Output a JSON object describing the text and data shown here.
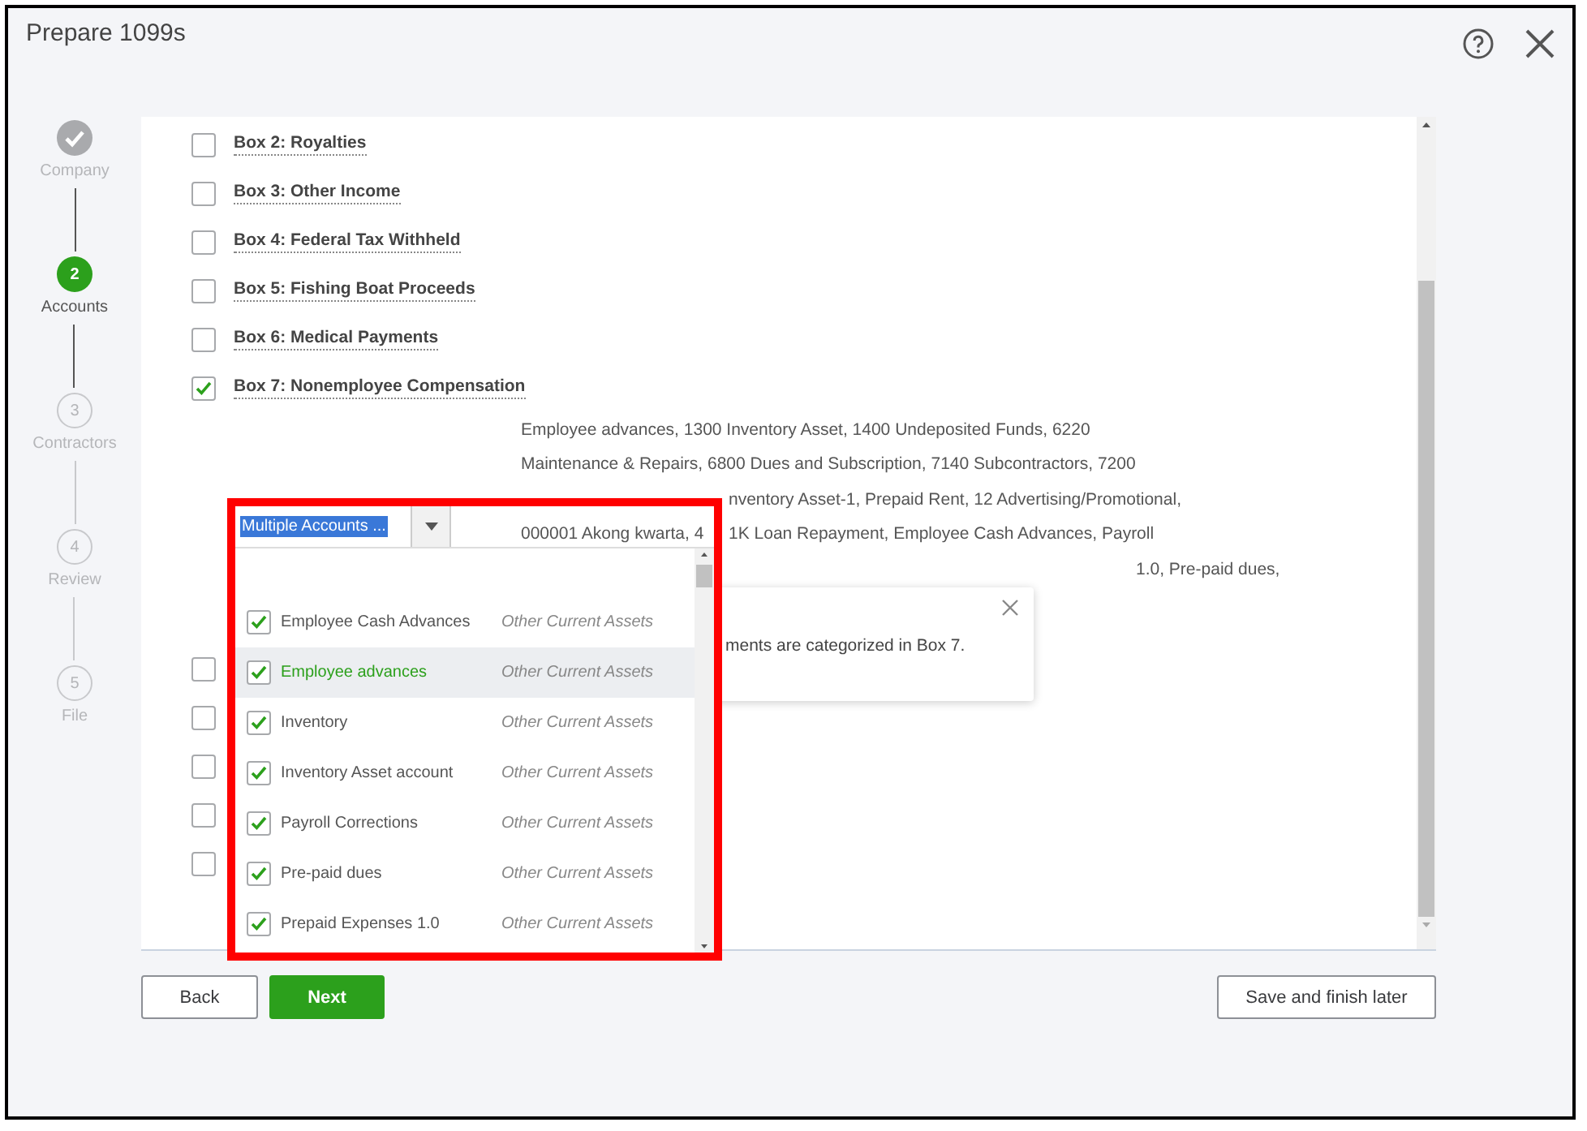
{
  "window": {
    "title": "Prepare 1099s"
  },
  "steps": [
    {
      "label": "Company",
      "completed": true,
      "selected": false
    },
    {
      "number": "2",
      "label": "Accounts",
      "completed": false,
      "selected": true
    },
    {
      "number": "3",
      "label": "Contractors",
      "completed": false,
      "selected": false
    },
    {
      "number": "4",
      "label": "Review",
      "completed": false,
      "selected": false
    },
    {
      "number": "5",
      "label": "File",
      "completed": false,
      "selected": false
    }
  ],
  "boxes": [
    {
      "label": "Box 2: Royalties",
      "checked": false
    },
    {
      "label": "Box 3: Other Income",
      "checked": false
    },
    {
      "label": "Box 4: Federal Tax Withheld",
      "checked": false
    },
    {
      "label": "Box 5: Fishing Boat Proceeds",
      "checked": false
    },
    {
      "label": "Box 6: Medical Payments",
      "checked": false
    },
    {
      "label": "Box 7: Nonemployee Compensation",
      "checked": true
    }
  ],
  "account_lines": [
    {
      "segments": [
        {
          "kind": "full",
          "text": "Employee advances, 1300 Inventory Asset, 1400 Undeposited Funds, 6220"
        }
      ]
    },
    {
      "segments": [
        {
          "kind": "full",
          "text": "Maintenance & Repairs, 6800 Dues and Subscription, 7140 Subcontractors, 7200"
        }
      ]
    },
    {
      "segments": [
        {
          "kind": "after_popup",
          "text": "nventory Asset-1, Prepaid Rent, 12 Advertising/Promotional,"
        }
      ]
    },
    {
      "segments": [
        {
          "kind": "lead",
          "text": "000001 Akong kwarta, 4"
        },
        {
          "kind": "after_popup",
          "text": "1K Loan Repayment, Employee Cash Advances, Payroll"
        }
      ]
    },
    {
      "segments": [
        {
          "kind": "after_tooltip",
          "text": "1.0, Pre-paid dues,"
        }
      ]
    }
  ],
  "lower_boxes": [
    {
      "checked": false
    },
    {
      "checked": false
    },
    {
      "checked": false
    },
    {
      "checked": false
    },
    {
      "checked": false
    }
  ],
  "tooltip": {
    "text": "ments are categorized in Box 7."
  },
  "account_picker": {
    "value": "Multiple Accounts ...",
    "items": [
      {
        "name": "Employee Cash Advances",
        "type": "Other Current Assets",
        "checked": true,
        "selected": false
      },
      {
        "name": "Employee advances",
        "type": "Other Current Assets",
        "checked": true,
        "selected": true
      },
      {
        "name": "Inventory",
        "type": "Other Current Assets",
        "checked": true,
        "selected": false
      },
      {
        "name": "Inventory Asset account",
        "type": "Other Current Assets",
        "checked": true,
        "selected": false
      },
      {
        "name": "Payroll Corrections",
        "type": "Other Current Assets",
        "checked": true,
        "selected": false
      },
      {
        "name": "Pre-paid dues",
        "type": "Other Current Assets",
        "checked": true,
        "selected": false
      },
      {
        "name": "Prepaid Expenses 1.0",
        "type": "Other Current Assets",
        "checked": true,
        "selected": false
      }
    ]
  },
  "footer": {
    "left_buttons": [
      {
        "label": "Back",
        "kind": "secondary"
      },
      {
        "label": "Next",
        "kind": "primary"
      }
    ],
    "right_buttons": [
      {
        "label": "Save and finish later",
        "kind": "secondary"
      }
    ]
  }
}
